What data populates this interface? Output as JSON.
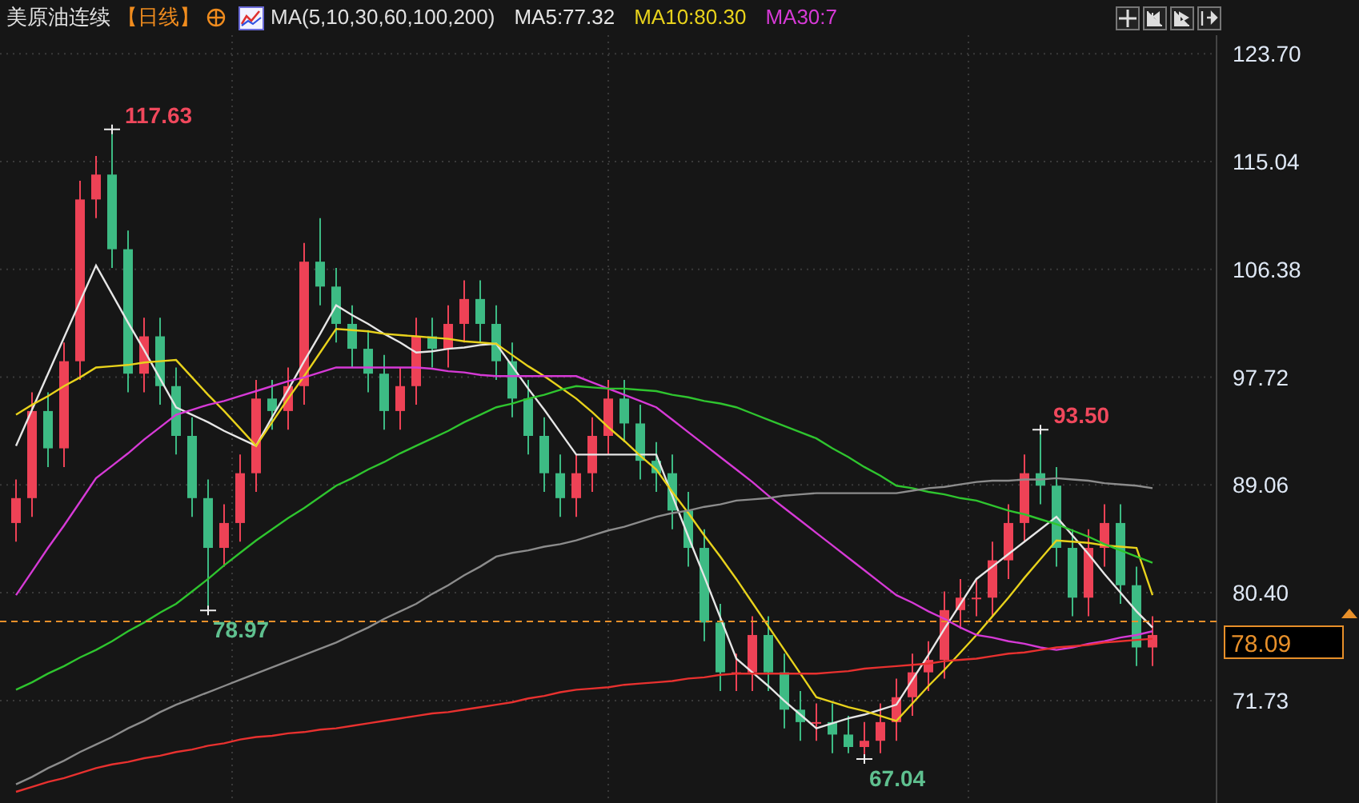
{
  "header": {
    "title": "美原油连续",
    "period": "【日线】",
    "indicator": "MA(5,10,30,60,100,200)",
    "values": [
      {
        "label": "MA5:77.32",
        "color": "#e6e6e6"
      },
      {
        "label": "MA10:80.30",
        "color": "#e8d21c"
      },
      {
        "label": "MA30:7",
        "color": "#d63ad6"
      }
    ]
  },
  "chart": {
    "chart_data": {
      "type": "candlestick",
      "grid": true,
      "ylim": [
        63.5,
        125.2
      ],
      "yticks": [
        {
          "value": 71.73,
          "label": "71.73"
        },
        {
          "value": 80.4,
          "label": "80.40"
        },
        {
          "value": 89.06,
          "label": "89.06"
        },
        {
          "value": 97.72,
          "label": "97.72"
        },
        {
          "value": 106.38,
          "label": "106.38"
        },
        {
          "value": 115.04,
          "label": "115.04"
        },
        {
          "value": 123.7,
          "label": "123.70"
        }
      ],
      "ohlc": [
        [
          86,
          89.5,
          84.5,
          88
        ],
        [
          88,
          96.5,
          86.5,
          95
        ],
        [
          95,
          96.5,
          90.5,
          92
        ],
        [
          92,
          100.5,
          90.5,
          99
        ],
        [
          99,
          113.5,
          97.5,
          112
        ],
        [
          112,
          115.5,
          110.5,
          114
        ],
        [
          114,
          117.63,
          106.5,
          108
        ],
        [
          108,
          109.5,
          96.5,
          98
        ],
        [
          98,
          102.5,
          96.5,
          101
        ],
        [
          101,
          102.5,
          95.5,
          97
        ],
        [
          97,
          98.5,
          91.5,
          93
        ],
        [
          93,
          94.5,
          86.5,
          88
        ],
        [
          88,
          89.5,
          78.97,
          84
        ],
        [
          84,
          87.5,
          82.5,
          86
        ],
        [
          86,
          91.5,
          84.5,
          90
        ],
        [
          90,
          97.5,
          88.5,
          96
        ],
        [
          96,
          97.5,
          93.5,
          95
        ],
        [
          95,
          98.5,
          93.5,
          97
        ],
        [
          97,
          108.5,
          95.5,
          107
        ],
        [
          107,
          110.5,
          103.5,
          105
        ],
        [
          105,
          106.5,
          100.5,
          102
        ],
        [
          102,
          103.5,
          98.5,
          100
        ],
        [
          100,
          101.5,
          96.5,
          98
        ],
        [
          98,
          99.5,
          93.5,
          95
        ],
        [
          95,
          98.5,
          93.5,
          97
        ],
        [
          97,
          102.5,
          95.5,
          101
        ],
        [
          101,
          102.5,
          98.5,
          100
        ],
        [
          100,
          103.5,
          98.5,
          102
        ],
        [
          102,
          105.5,
          100.5,
          104
        ],
        [
          104,
          105.5,
          100.5,
          102
        ],
        [
          102,
          103.5,
          97.5,
          99
        ],
        [
          99,
          100.5,
          94.5,
          96
        ],
        [
          96,
          97.5,
          91.5,
          93
        ],
        [
          93,
          94.5,
          88.5,
          90
        ],
        [
          90,
          91.5,
          86.5,
          88
        ],
        [
          88,
          91.5,
          86.5,
          90
        ],
        [
          90,
          94.5,
          88.5,
          93
        ],
        [
          93,
          97.5,
          91.5,
          96
        ],
        [
          96,
          97.5,
          92.5,
          94
        ],
        [
          94,
          95.5,
          89.5,
          91
        ],
        [
          91,
          92.5,
          88.5,
          90
        ],
        [
          90,
          91.5,
          85.5,
          87
        ],
        [
          87,
          88.5,
          82.5,
          84
        ],
        [
          84,
          85.5,
          76.5,
          78
        ],
        [
          78,
          79.5,
          72.5,
          74
        ],
        [
          74,
          75.5,
          72.5,
          74
        ],
        [
          74,
          78.5,
          72.5,
          77
        ],
        [
          77,
          78.5,
          72.5,
          74
        ],
        [
          74,
          75.5,
          69.5,
          71
        ],
        [
          71,
          72.5,
          68.5,
          70
        ],
        [
          70,
          71.5,
          68.5,
          70
        ],
        [
          70,
          71.5,
          67.5,
          69
        ],
        [
          69,
          70.5,
          67.5,
          68
        ],
        [
          68,
          70,
          67.04,
          68.5
        ],
        [
          68.5,
          71.5,
          67.5,
          70
        ],
        [
          70,
          73.5,
          68.5,
          72
        ],
        [
          72,
          75.5,
          70.5,
          74
        ],
        [
          74,
          76.5,
          72.5,
          75
        ],
        [
          75,
          80.5,
          73.5,
          79
        ],
        [
          79,
          81.5,
          77.5,
          80
        ],
        [
          80,
          81.5,
          78.5,
          80
        ],
        [
          80,
          84.5,
          78.5,
          83
        ],
        [
          83,
          87.5,
          81.5,
          86
        ],
        [
          86,
          91.5,
          84.5,
          90
        ],
        [
          90,
          93.5,
          87.5,
          89
        ],
        [
          89,
          90.5,
          82.5,
          84
        ],
        [
          84,
          85.5,
          78.5,
          80
        ],
        [
          80,
          85.5,
          78.5,
          84
        ],
        [
          84,
          87.5,
          82.5,
          86
        ],
        [
          86,
          87.5,
          79.5,
          81
        ],
        [
          81,
          82.5,
          74.5,
          76
        ],
        [
          76,
          78.5,
          74.5,
          77
        ]
      ],
      "series": [
        {
          "type": "line",
          "color": "#e6e6e6",
          "values": [
            92.2,
            95.1,
            98.0,
            100.9,
            103.8,
            106.7,
            104.4,
            102.1,
            99.9,
            97.6,
            95.3,
            94.7,
            94.1,
            93.4,
            92.8,
            92.2,
            94.5,
            96.7,
            99.0,
            101.2,
            103.5,
            102.7,
            102.0,
            101.2,
            100.5,
            99.7,
            99.8,
            100.0,
            100.1,
            100.3,
            100.4,
            98.6,
            96.8,
            95.1,
            93.3,
            91.5,
            91.5,
            91.5,
            91.5,
            91.5,
            91.5,
            88.2,
            84.9,
            81.7,
            78.4,
            75.1,
            74.0,
            72.9,
            71.7,
            70.6,
            69.5,
            69.9,
            70.3,
            70.6,
            71.0,
            71.4,
            73.4,
            75.4,
            77.5,
            79.5,
            81.5,
            82.5,
            83.5,
            84.5,
            85.5,
            86.5,
            85.0,
            83.5,
            81.9,
            80.4,
            78.9,
            77.6
          ]
        },
        {
          "type": "line",
          "color": "#e8d21c",
          "values": [
            94.7,
            95.5,
            96.2,
            97.0,
            97.7,
            98.5,
            98.6,
            98.7,
            98.9,
            99.0,
            99.1,
            97.7,
            96.3,
            95.0,
            93.6,
            92.2,
            94.1,
            96.0,
            97.8,
            99.7,
            101.6,
            101.5,
            101.4,
            101.2,
            101.1,
            101.0,
            100.9,
            100.8,
            100.6,
            100.5,
            100.4,
            99.5,
            98.6,
            97.8,
            96.9,
            96.0,
            94.9,
            93.7,
            92.6,
            91.4,
            90.3,
            88.5,
            86.8,
            85.0,
            83.3,
            81.5,
            79.6,
            77.7,
            75.8,
            73.9,
            72.0,
            71.6,
            71.2,
            70.9,
            70.5,
            70.1,
            71.5,
            72.9,
            74.2,
            75.6,
            77.0,
            78.5,
            80.0,
            81.6,
            83.1,
            84.6,
            84.5,
            84.4,
            84.2,
            84.1,
            84.0,
            80.2
          ]
        },
        {
          "type": "line",
          "color": "#d63ad6",
          "values": [
            80.2,
            82.1,
            84.0,
            85.8,
            87.7,
            89.6,
            90.6,
            91.6,
            92.7,
            93.7,
            94.7,
            95.1,
            95.5,
            95.8,
            96.2,
            96.6,
            97.0,
            97.4,
            97.7,
            98.1,
            98.5,
            98.5,
            98.5,
            98.5,
            98.5,
            98.5,
            98.4,
            98.2,
            98.1,
            97.9,
            97.8,
            97.8,
            97.8,
            97.8,
            97.8,
            97.8,
            97.3,
            96.8,
            96.3,
            95.8,
            95.3,
            94.3,
            93.3,
            92.3,
            91.3,
            90.3,
            89.3,
            88.2,
            87.2,
            86.2,
            85.2,
            84.2,
            83.2,
            82.2,
            81.2,
            80.2,
            79.6,
            78.9,
            78.3,
            77.6,
            77.0,
            76.8,
            76.5,
            76.3,
            76.0,
            75.8,
            76.0,
            76.3,
            76.5,
            76.8,
            77.0,
            77.3
          ]
        },
        {
          "type": "line",
          "color": "#2fc52f",
          "values": [
            72.6,
            73.2,
            73.9,
            74.5,
            75.2,
            75.8,
            76.5,
            77.3,
            78.0,
            78.8,
            79.5,
            80.5,
            81.5,
            82.6,
            83.6,
            84.6,
            85.5,
            86.4,
            87.2,
            88.1,
            89.0,
            89.6,
            90.3,
            90.9,
            91.6,
            92.2,
            92.8,
            93.4,
            94.1,
            94.7,
            95.3,
            95.6,
            96.0,
            96.3,
            96.7,
            97.0,
            96.9,
            96.8,
            96.8,
            96.7,
            96.6,
            96.3,
            96.1,
            95.8,
            95.6,
            95.3,
            94.8,
            94.3,
            93.8,
            93.3,
            92.8,
            92.0,
            91.3,
            90.5,
            89.8,
            89.0,
            88.8,
            88.5,
            88.3,
            88.0,
            87.8,
            87.4,
            87.0,
            86.7,
            86.3,
            85.9,
            85.4,
            84.9,
            84.3,
            83.8,
            83.3,
            82.8
          ]
        },
        {
          "type": "line",
          "color": "#8c8c8c",
          "values": [
            65.0,
            65.6,
            66.3,
            66.9,
            67.6,
            68.2,
            68.8,
            69.5,
            70.1,
            70.8,
            71.4,
            71.9,
            72.4,
            72.9,
            73.4,
            73.9,
            74.4,
            74.9,
            75.4,
            75.9,
            76.4,
            77.0,
            77.6,
            78.3,
            78.9,
            79.5,
            80.3,
            81.0,
            81.8,
            82.5,
            83.3,
            83.6,
            83.8,
            84.1,
            84.3,
            84.6,
            85.0,
            85.4,
            85.7,
            86.1,
            86.5,
            86.8,
            87.0,
            87.3,
            87.5,
            87.8,
            87.9,
            88.0,
            88.2,
            88.3,
            88.4,
            88.4,
            88.4,
            88.4,
            88.4,
            88.4,
            88.6,
            88.8,
            88.9,
            89.1,
            89.3,
            89.4,
            89.4,
            89.5,
            89.5,
            89.6,
            89.5,
            89.4,
            89.2,
            89.1,
            89.0,
            88.8
          ]
        },
        {
          "type": "line",
          "color": "#e8312f",
          "values": [
            64.4,
            64.8,
            65.2,
            65.5,
            65.9,
            66.3,
            66.6,
            66.8,
            67.1,
            67.3,
            67.6,
            67.8,
            68.1,
            68.3,
            68.6,
            68.8,
            68.9,
            69.1,
            69.2,
            69.4,
            69.5,
            69.7,
            69.9,
            70.1,
            70.3,
            70.5,
            70.7,
            70.8,
            71.0,
            71.2,
            71.4,
            71.6,
            71.9,
            72.1,
            72.4,
            72.6,
            72.7,
            72.8,
            73.0,
            73.1,
            73.2,
            73.3,
            73.5,
            73.6,
            73.8,
            73.9,
            73.9,
            73.9,
            73.9,
            73.9,
            73.9,
            74.0,
            74.1,
            74.3,
            74.4,
            74.5,
            74.6,
            74.7,
            74.9,
            75.0,
            75.1,
            75.3,
            75.5,
            75.6,
            75.8,
            76.0,
            76.1,
            76.2,
            76.4,
            76.5,
            76.6,
            76.7
          ]
        }
      ],
      "annotations": [
        "117.63",
        "78.97",
        "93.50",
        "67.04"
      ],
      "ref_lines": [
        {
          "axis": "y",
          "value": 78.09,
          "label": "78.09"
        }
      ]
    }
  }
}
